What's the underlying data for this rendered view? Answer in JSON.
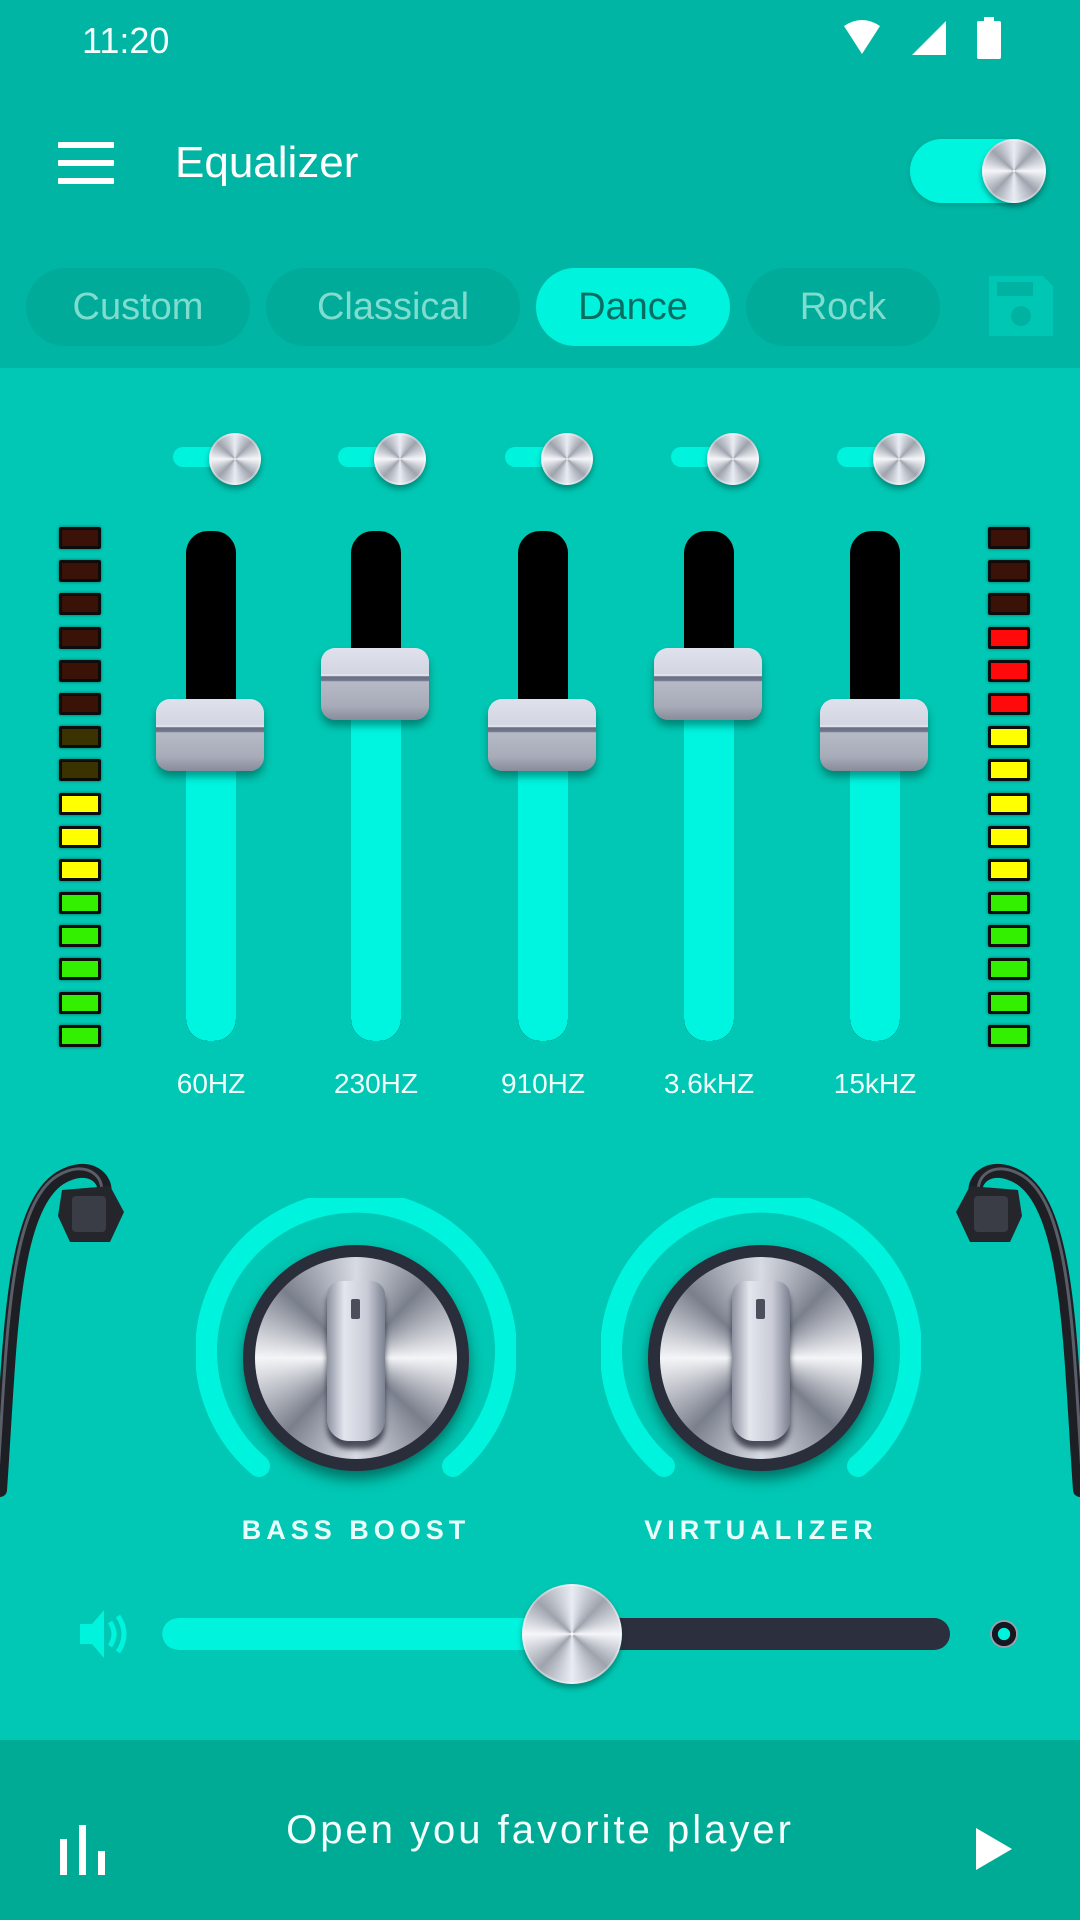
{
  "status_bar": {
    "time": "11:20",
    "icons": [
      "wifi-icon",
      "cellular-signal-icon",
      "battery-icon"
    ]
  },
  "header": {
    "menu_icon": "hamburger-menu-icon",
    "title": "Equalizer",
    "power_toggle": {
      "state": "on"
    }
  },
  "presets": {
    "tabs": [
      {
        "label": "Custom",
        "active": false
      },
      {
        "label": "Classical",
        "active": false
      },
      {
        "label": "Dance",
        "active": true
      },
      {
        "label": "Rock",
        "active": false
      }
    ],
    "save_icon": "floppy-disk-save-icon"
  },
  "equalizer": {
    "bands": [
      {
        "label": "60HZ",
        "switch": "on",
        "level": 0.6
      },
      {
        "label": "230HZ",
        "switch": "on",
        "level": 0.7
      },
      {
        "label": "910HZ",
        "switch": "on",
        "level": 0.6
      },
      {
        "label": "3.6kHZ",
        "switch": "on",
        "level": 0.7
      },
      {
        "label": "15kHZ",
        "switch": "on",
        "level": 0.6
      }
    ],
    "vu_meters": {
      "left": {
        "segments": 16,
        "lit": 8
      },
      "right": {
        "segments": 16,
        "lit": 13
      }
    },
    "vu_colors": {
      "green_on": "#33f000",
      "yellow_on": "#ffff00",
      "red_on": "#ff0a0a",
      "green_off": "#1f3a00",
      "yellow_off": "#3a3300",
      "red_off": "#3a1208"
    }
  },
  "effects": {
    "bass_boost": {
      "label": "BASS BOOST",
      "level": 0.5
    },
    "virtualizer": {
      "label": "VIRTUALIZER",
      "level": 0.5
    }
  },
  "volume": {
    "icon": "speaker-volume-icon",
    "level": 0.52
  },
  "bottom_bar": {
    "left_icon": "equalizer-bars-icon",
    "text": "Open you favorite player",
    "right_icon": "play-icon"
  },
  "colors": {
    "accent": "#00f3dd",
    "background": "#00c8b4",
    "header": "#00b5a3",
    "bottom_bar": "#00ab96"
  }
}
